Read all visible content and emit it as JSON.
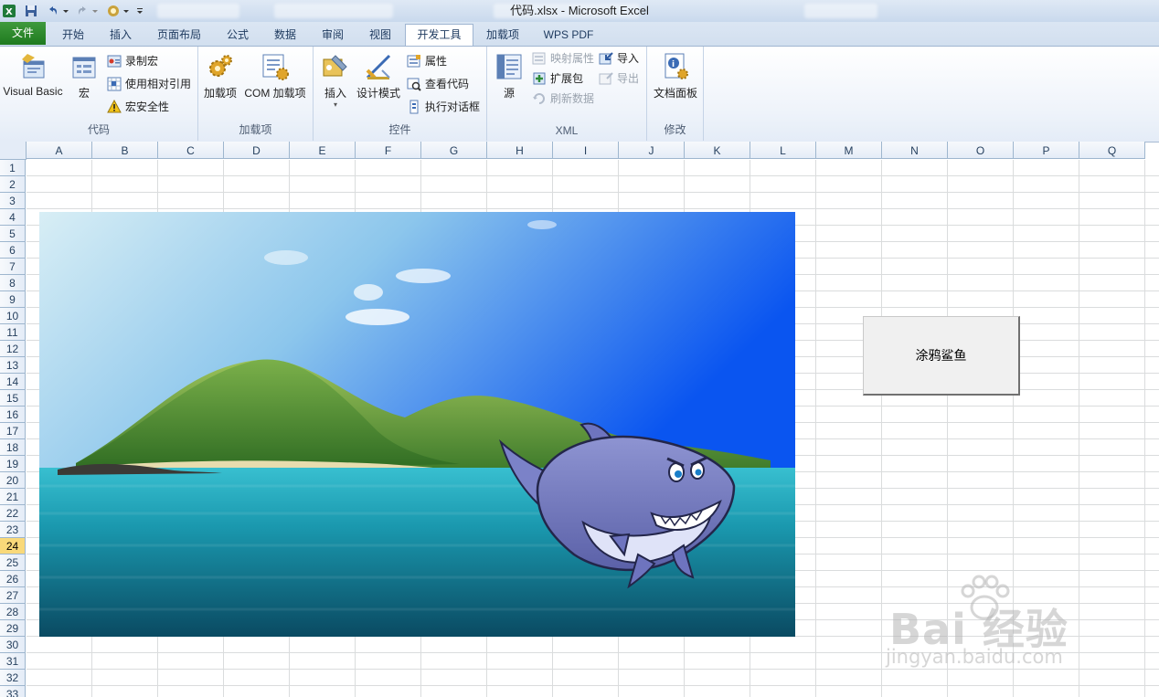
{
  "window": {
    "title": "代码.xlsx  -  Microsoft Excel"
  },
  "ribbon_tabs": [
    {
      "label": "文件"
    },
    {
      "label": "开始"
    },
    {
      "label": "插入"
    },
    {
      "label": "页面布局"
    },
    {
      "label": "公式"
    },
    {
      "label": "数据"
    },
    {
      "label": "审阅"
    },
    {
      "label": "视图"
    },
    {
      "label": "开发工具"
    },
    {
      "label": "加载项"
    },
    {
      "label": "WPS PDF"
    }
  ],
  "groups": {
    "code": {
      "label": "代码",
      "visual_basic": "Visual Basic",
      "macros": "宏",
      "record_macro": "录制宏",
      "relative_ref": "使用相对引用",
      "macro_security": "宏安全性"
    },
    "addins": {
      "label": "加载项",
      "addins": "加载项",
      "com_addins": "COM 加载项"
    },
    "controls": {
      "label": "控件",
      "insert": "插入",
      "design_mode": "设计模式",
      "properties": "属性",
      "view_code": "查看代码",
      "run_dialog": "执行对话框"
    },
    "xml": {
      "label": "XML",
      "source": "源",
      "map_properties": "映射属性",
      "expansion_packs": "扩展包",
      "refresh_data": "刷新数据",
      "import": "导入",
      "export": "导出"
    },
    "modify": {
      "label": "修改",
      "document_panel": "文档面板"
    }
  },
  "columns": [
    "A",
    "B",
    "C",
    "D",
    "E",
    "F",
    "G",
    "H",
    "I",
    "J",
    "K",
    "L",
    "M",
    "N",
    "O",
    "P",
    "Q"
  ],
  "rows": [
    "1",
    "2",
    "3",
    "4",
    "5",
    "6",
    "7",
    "8",
    "9",
    "10",
    "11",
    "12",
    "13",
    "14",
    "15",
    "16",
    "17",
    "18",
    "19",
    "20",
    "21",
    "22",
    "23",
    "24",
    "25",
    "26",
    "27",
    "28",
    "29",
    "30",
    "31",
    "32",
    "33"
  ],
  "selected_row": "24",
  "form_button": {
    "label": "涂鸦鲨鱼"
  },
  "watermark": {
    "brand": "Bai 经验",
    "url": "jingyan.baidu.com"
  },
  "colors": {
    "file_tab": "#2a8a2a",
    "ribbon_bg": "#eef3fa",
    "selected_header": "#f9d97a",
    "gridline": "#dadcdd"
  }
}
